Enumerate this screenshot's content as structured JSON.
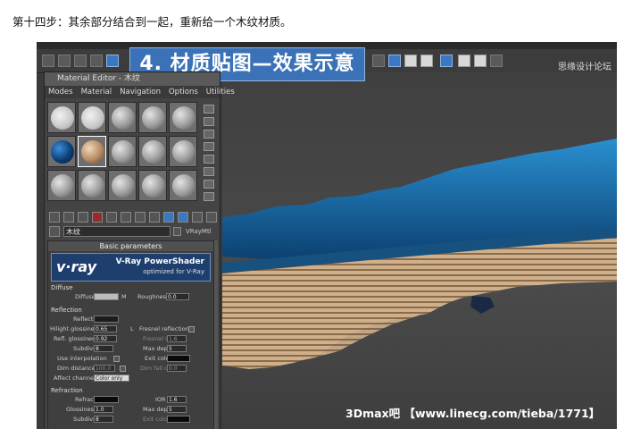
{
  "caption": "第十四步：其余部分结合到一起，重新给一个木纹材质。",
  "banner": "4. 材质贴图—效果示意",
  "watermark_top": "思缘设计论坛",
  "watermark_bottom": "3Dmax吧 【www.linecg.com/tieba/1771】",
  "material_editor": {
    "title": "Material Editor - 木纹",
    "menu": [
      "Modes",
      "Material",
      "Navigation",
      "Options",
      "Utilities"
    ],
    "material_name": "木纹",
    "material_type": "VRayMtl",
    "rollout": "Basic parameters",
    "vray_logo": "v·ray",
    "vray_title": "V-Ray PowerShader",
    "vray_subtitle": "optimized for V-Ray",
    "diffuse": {
      "section": "Diffuse",
      "diffuse_label": "Diffuse",
      "map_btn": "M",
      "roughness_label": "Roughness",
      "roughness_value": "0.0"
    },
    "reflection": {
      "section": "Reflection",
      "reflect_label": "Reflect",
      "hilight_label": "Hilight glossiness",
      "hilight_value": "0.65",
      "lock": "L",
      "fresnel_label": "Fresnel reflections",
      "refl_gloss_label": "Refl. glossiness",
      "refl_gloss_value": "0.92",
      "fresnel_ior_label": "Fresnel IOR",
      "fresnel_ior_value": "1.6",
      "subdivs_label": "Subdivs",
      "subdivs_value": "8",
      "max_depth_label": "Max depth",
      "max_depth_value": "5",
      "use_interp_label": "Use interpolation",
      "exit_color_label": "Exit color",
      "dim_distance_label": "Dim distance",
      "dim_distance_value": "100.0",
      "dim_falloff_label": "Dim fall off",
      "dim_falloff_value": "0.0",
      "affect_channels_label": "Affect channels",
      "affect_channels_value": "Color only"
    },
    "refraction": {
      "section": "Refraction",
      "refract_label": "Refract",
      "ior_label": "IOR",
      "ior_value": "1.6",
      "glossiness_label": "Glossiness",
      "glossiness_value": "1.0",
      "max_depth_label": "Max depth",
      "max_depth_value": "5",
      "subdivs_label": "Subdivs",
      "subdivs_value": "8",
      "exit_color_label": "Exit color"
    }
  },
  "colors": {
    "banner_blue": "#3b72b7",
    "water_blue": "#1f78b8",
    "wood": "#cfb08b"
  }
}
